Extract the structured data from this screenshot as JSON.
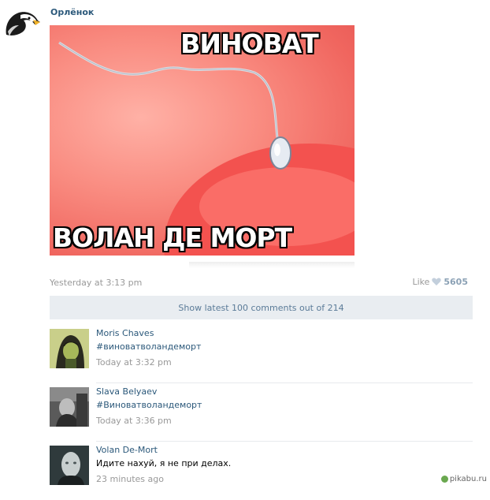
{
  "post": {
    "author": "Орлёнок",
    "meme_top": "ВИНОВАТ",
    "meme_bottom": "ВОЛАН ДЕ МОРТ",
    "time": "Yesterday at 3:13 pm",
    "like_label": "Like",
    "like_count": "5605"
  },
  "comments_bar": {
    "label": "Show latest 100 comments out of 214"
  },
  "comments": [
    {
      "name": "Moris Chaves",
      "text": "#виноватволандеморт",
      "time": "Today at 3:32 pm"
    },
    {
      "name": "Slava Belyaev",
      "text": "#Виноватволандеморт",
      "time": "Today at 3:36 pm"
    },
    {
      "name": "Volan De-Mort",
      "text": "Идите нахуй, я не при делах.",
      "time": "23 minutes ago"
    }
  ],
  "watermark": "pikabu.ru",
  "colors": {
    "link": "#2b587a",
    "muted": "#999999",
    "bar_bg": "#e9edf1",
    "bar_text": "#5b7b98"
  }
}
